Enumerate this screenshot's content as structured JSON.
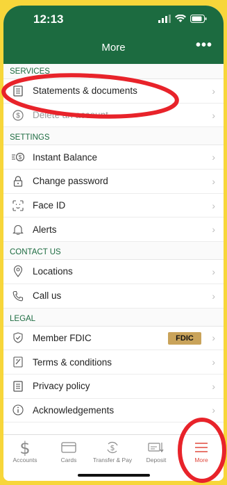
{
  "status_bar": {
    "time": "12:13"
  },
  "header": {
    "title": "More",
    "more_icon": "ellipsis-icon"
  },
  "sections": {
    "services": {
      "title": "SERVICES",
      "items": [
        {
          "label": "Statements & documents",
          "icon": "document-icon"
        },
        {
          "label": "Delete an account",
          "icon": "dollar-circle-icon"
        }
      ]
    },
    "settings": {
      "title": "SETTINGS",
      "items": [
        {
          "label": "Instant Balance",
          "icon": "instant-balance-icon"
        },
        {
          "label": "Change password",
          "icon": "lock-icon"
        },
        {
          "label": "Face ID",
          "icon": "face-id-icon"
        },
        {
          "label": "Alerts",
          "icon": "bell-icon"
        }
      ]
    },
    "contact": {
      "title": "CONTACT US",
      "items": [
        {
          "label": "Locations",
          "icon": "location-pin-icon"
        },
        {
          "label": "Call us",
          "icon": "phone-icon"
        }
      ]
    },
    "legal": {
      "title": "LEGAL",
      "items": [
        {
          "label": "Member FDIC",
          "icon": "shield-check-icon",
          "badge": "FDIC"
        },
        {
          "label": "Terms & conditions",
          "icon": "pencil-document-icon"
        },
        {
          "label": "Privacy policy",
          "icon": "document-icon"
        },
        {
          "label": "Acknowledgements",
          "icon": "info-icon"
        }
      ]
    }
  },
  "tabbar": {
    "items": [
      {
        "label": "Accounts",
        "icon": "dollar-icon",
        "active": false
      },
      {
        "label": "Cards",
        "icon": "card-icon",
        "active": false
      },
      {
        "label": "Transfer & Pay",
        "icon": "transfer-icon",
        "active": false
      },
      {
        "label": "Deposit",
        "icon": "deposit-check-icon",
        "active": false
      },
      {
        "label": "More",
        "icon": "menu-icon",
        "active": true
      }
    ]
  },
  "colors": {
    "header_green": "#1c6b40",
    "section_green": "#1c6b40",
    "active_tab": "#e0483d",
    "annotation_red": "#e8232a",
    "background_yellow": "#f7d63a"
  }
}
